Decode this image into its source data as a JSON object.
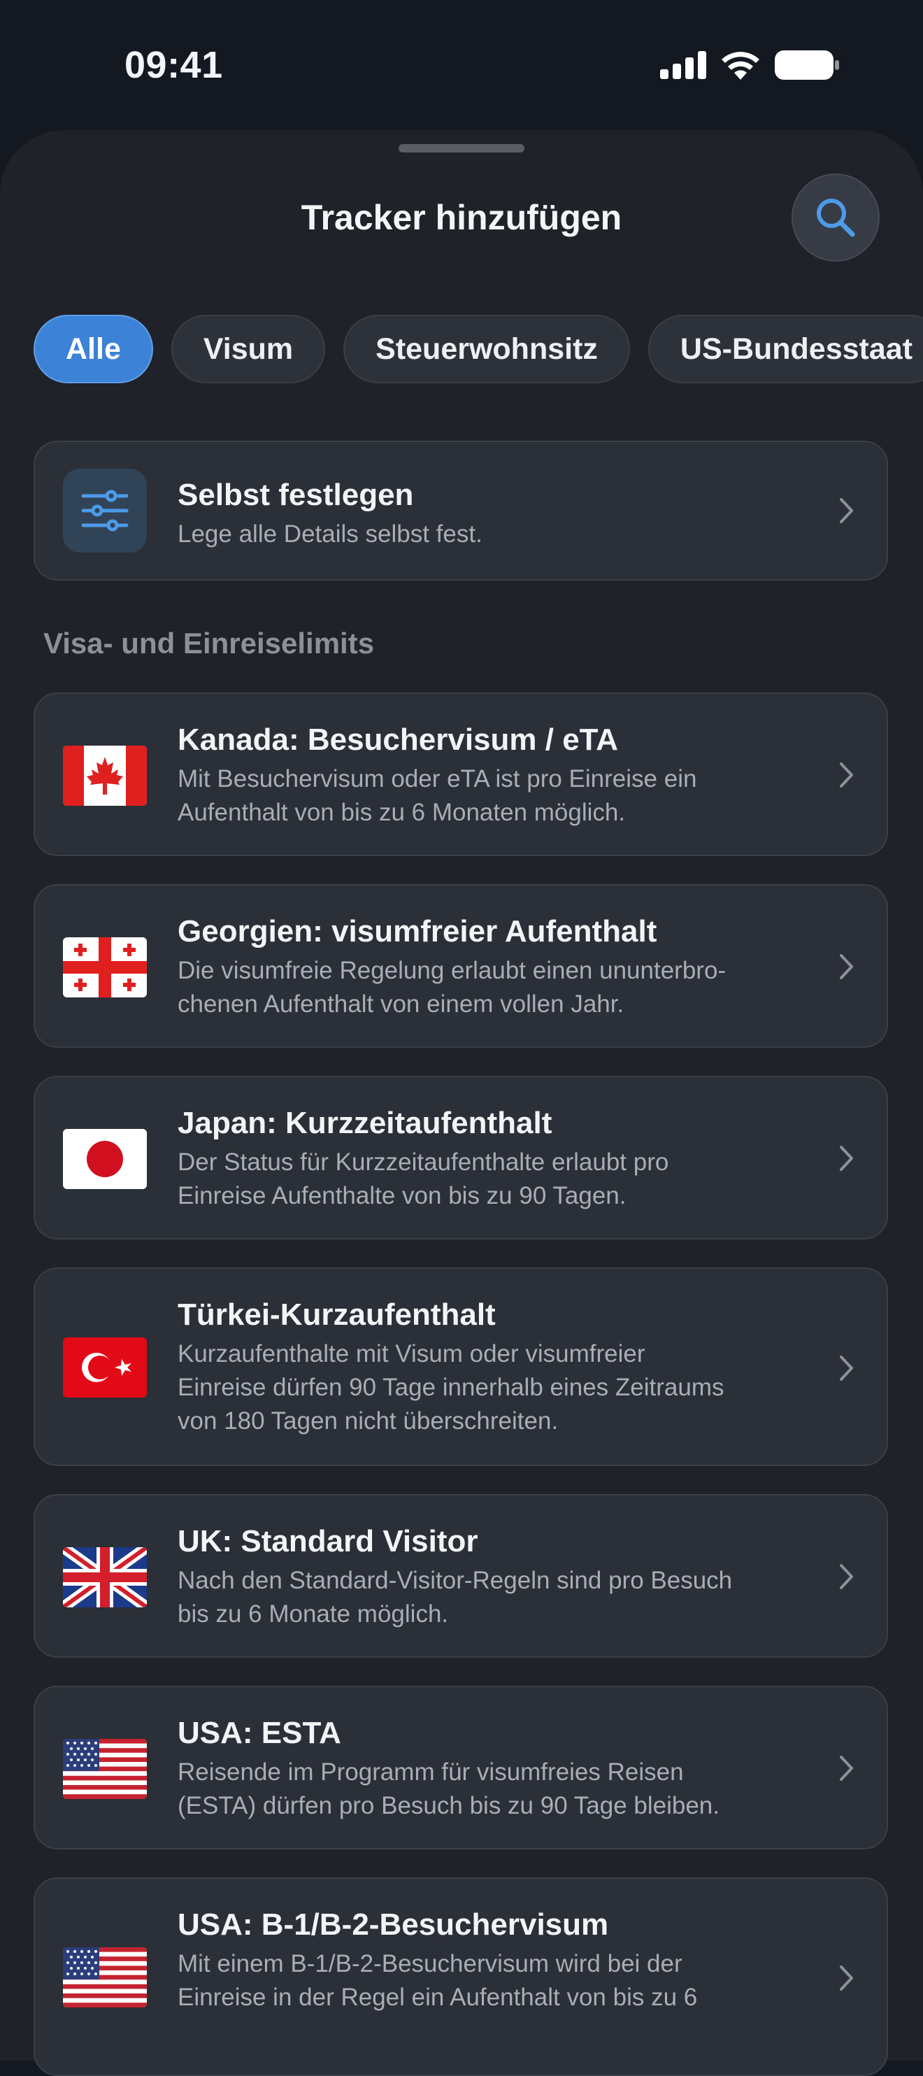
{
  "status": {
    "time": "09:41"
  },
  "sheet": {
    "title": "Tracker hinzufügen"
  },
  "filters": [
    {
      "label": "Alle",
      "selected": true
    },
    {
      "label": "Visum",
      "selected": false
    },
    {
      "label": "Steuerwohnsitz",
      "selected": false
    },
    {
      "label": "US-Bundesstaat",
      "selected": false
    }
  ],
  "custom": {
    "title": "Selbst festlegen",
    "subtitle": "Lege alle Details selbst fest.",
    "icon": "sliders-icon"
  },
  "section": {
    "title": "Visa- und Einreiselimits"
  },
  "trackers": [
    {
      "flag": "canada-flag-icon",
      "title": "Kanada: Besuchervisum / eTA",
      "lines": [
        "Mit Besuchervisum oder eTA ist pro Einreise ein",
        "Aufenthalt von bis zu 6 Monaten möglich."
      ]
    },
    {
      "flag": "georgia-flag-icon",
      "title": "Georgien: visumfreier Aufenthalt",
      "lines": [
        "Die visumfreie Regelung erlaubt einen ununterbro-",
        "chenen Aufenthalt von einem vollen Jahr."
      ]
    },
    {
      "flag": "japan-flag-icon",
      "title": "Japan: Kurzzeitaufenthalt",
      "lines": [
        "Der Status für Kurzzeitaufenthalte erlaubt pro",
        "Einreise Aufenthalte von bis zu 90 Tagen."
      ]
    },
    {
      "flag": "turkey-flag-icon",
      "title": "Türkei-Kurzaufenthalt",
      "lines": [
        "Kurzaufenthalte mit Visum oder visumfreier",
        "Einreise dürfen 90 Tage innerhalb eines Zeitraums",
        "von 180 Tagen nicht überschreiten."
      ]
    },
    {
      "flag": "uk-flag-icon",
      "title": "UK: Standard Visitor",
      "lines": [
        "Nach den Standard-Visitor-Regeln sind pro Besuch",
        "bis zu 6 Monate möglich."
      ]
    },
    {
      "flag": "usa-flag-icon",
      "title": "USA: ESTA",
      "lines": [
        "Reisende im Programm für visumfreies Reisen",
        "(ESTA) dürfen pro Besuch bis zu 90 Tage bleiben."
      ]
    },
    {
      "flag": "usa-flag-icon",
      "title": "USA: B-1/B-2-Besuchervisum",
      "lines": [
        "Mit einem B-1/B-2-Besuchervisum wird bei der",
        "Einreise in der Regel ein Aufenthalt von bis zu 6"
      ]
    }
  ],
  "colors": {
    "accent": "#3c82d6",
    "background": "#131821",
    "sheet": "#1f2228",
    "card": "#2b2f37"
  }
}
